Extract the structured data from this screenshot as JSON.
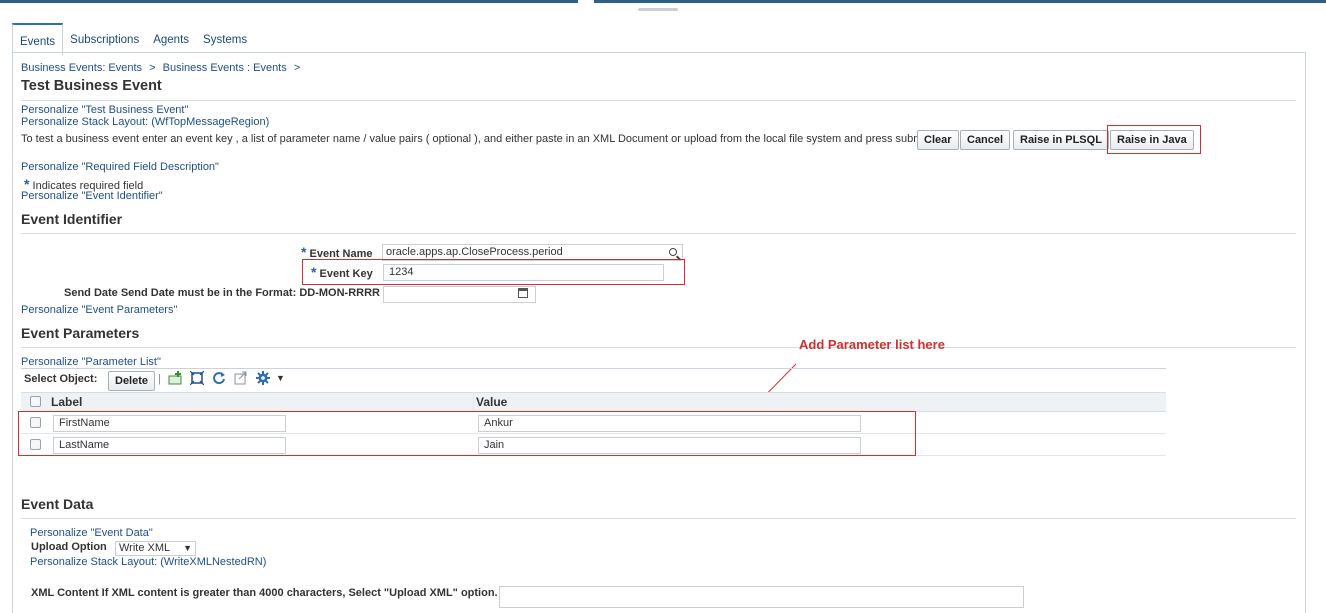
{
  "tabs": [
    "Events",
    "Subscriptions",
    "Agents",
    "Systems"
  ],
  "breadcrumb": {
    "item1": "Business Events: Events",
    "sep": ">",
    "item2": "Business Events : Events",
    "sep2": ">"
  },
  "page_title": "Test Business Event",
  "personalize": {
    "message": "Personalize \"Test Business Event\"",
    "stack_top": "Personalize Stack Layout: (WfTopMessageRegion)",
    "required_desc": "Personalize \"Required Field Description\"",
    "event_identifier": "Personalize \"Event Identifier\"",
    "event_parameters": "Personalize \"Event Parameters\"",
    "parameter_list": "Personalize \"Parameter List\"",
    "event_data": "Personalize \"Event Data\"",
    "stack_nested": "Personalize Stack Layout: (WriteXMLNestedRN)"
  },
  "instruction": "To test a business event enter an event key , a list of parameter name / value pairs ( optional ), and either paste in an XML Document or upload from the local file system and press submit.",
  "buttons": {
    "clear": "Clear",
    "cancel": "Cancel",
    "raise_plsql": "Raise in PLSQL",
    "raise_java": "Raise in Java",
    "delete": "Delete"
  },
  "required_note": {
    "star": "*",
    "text": "Indicates required field"
  },
  "sections": {
    "event_identifier": "Event Identifier",
    "event_parameters": "Event Parameters",
    "event_data": "Event Data"
  },
  "fields": {
    "event_name_label": "Event Name",
    "event_name_value": "oracle.apps.ap.CloseProcess.period",
    "event_key_label": "Event Key",
    "event_key_value": "1234",
    "send_date_label": "Send Date Send Date must be in the Format: DD-MON-RRRR",
    "send_date_value": "",
    "upload_option_label": "Upload Option",
    "upload_option_value": "Write XML",
    "xml_content_label": "XML Content If XML content is greater than 4000 characters, Select \"Upload XML\" option.",
    "xml_content_value": ""
  },
  "table": {
    "select_object": "Select Object:",
    "separator": "|",
    "columns": [
      "Label",
      "Value"
    ],
    "rows": [
      {
        "label": "FirstName",
        "value": "Ankur"
      },
      {
        "label": "LastName",
        "value": "Jain"
      }
    ]
  },
  "annotation": "Add Parameter list here",
  "colors": {
    "link": "#1f4f8a",
    "required_star": "#2c5ea8",
    "highlight": "#d32f2f",
    "tab_accent": "#2c6fb0"
  },
  "icons": [
    "search-icon",
    "calendar-icon",
    "add-row-icon",
    "detach-icon",
    "refresh-icon",
    "export-icon",
    "settings-gear-icon",
    "dropdown-arrow-icon"
  ]
}
